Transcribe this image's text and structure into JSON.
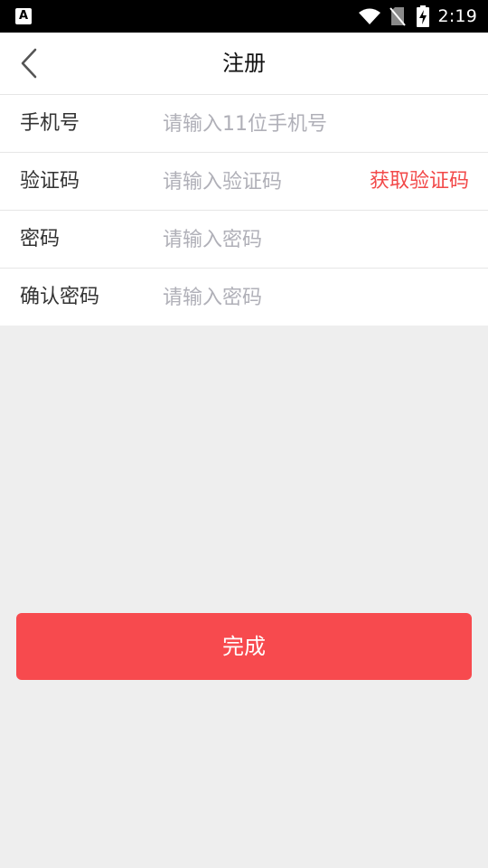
{
  "status_bar": {
    "notification_glyph": "A",
    "time": "2:19",
    "icons": [
      "app-notification-icon",
      "wifi-icon",
      "no-sim-icon",
      "battery-charging-icon"
    ]
  },
  "header": {
    "title": "注册",
    "back_icon": "chevron-left-icon"
  },
  "form": {
    "phone": {
      "label": "手机号",
      "placeholder": "请输入11位手机号",
      "value": ""
    },
    "code": {
      "label": "验证码",
      "placeholder": "请输入验证码",
      "value": "",
      "action_label": "获取验证码"
    },
    "password": {
      "label": "密码",
      "placeholder": "请输入密码",
      "value": ""
    },
    "confirm_password": {
      "label": "确认密码",
      "placeholder": "请输入密码",
      "value": ""
    }
  },
  "actions": {
    "submit_label": "完成"
  },
  "colors": {
    "accent": "#f74a4e",
    "link": "#f24949",
    "background": "#eeeeee",
    "placeholder": "#b0b0b8"
  }
}
